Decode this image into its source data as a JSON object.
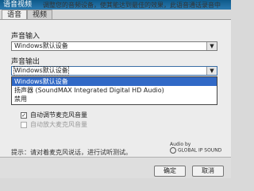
{
  "window": {
    "title": "语音视频"
  },
  "hint": "调整您的音频设备，使其能达到最佳的效果，此语音通话录音中",
  "tabs": [
    {
      "label": "语音"
    },
    {
      "label": "视频"
    }
  ],
  "input": {
    "label": "声音输入",
    "value": "Windows默认设备"
  },
  "output": {
    "label": "声音输出",
    "value": "Windows默认设备",
    "options": [
      "Windows默认设备",
      "扬声器 (SoundMAX Integrated Digital HD Audio)",
      "禁用"
    ]
  },
  "checkboxes": {
    "auto_adjust": {
      "label": "自动调节麦克风音量",
      "checked": true
    },
    "auto_boost": {
      "label": "自动放大麦克风音量",
      "checked": false
    }
  },
  "logo": {
    "line1": "Audio by",
    "line2": "GLOBAL IP SOUND"
  },
  "tip": "提示：请对着麦克风说话，进行试听测试。",
  "buttons": {
    "ok": "确定",
    "cancel": "取消"
  }
}
